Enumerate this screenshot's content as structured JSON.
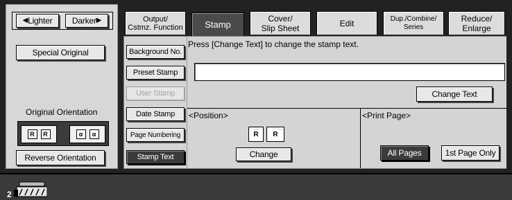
{
  "density": {
    "lighter_label": "Lighter",
    "darker_label": "Darker"
  },
  "left_panel": {
    "special_original_label": "Special Original",
    "original_orientation_label": "Original Orientation",
    "orientation_glyph_1": "R",
    "orientation_glyph_2": "R",
    "orientation_glyph_3": "α",
    "orientation_glyph_4": "α",
    "reverse_orientation_label": "Reverse Orientation"
  },
  "tabs": [
    {
      "line1": "Output/",
      "line2": "Cstmz. Function"
    },
    {
      "line1": "Stamp",
      "line2": ""
    },
    {
      "line1": "Cover/",
      "line2": "Slip Sheet"
    },
    {
      "line1": "Edit",
      "line2": ""
    },
    {
      "line1": "Dup./Combine/",
      "line2": "Series"
    },
    {
      "line1": "Reduce/",
      "line2": "Enlarge"
    }
  ],
  "stamp_menu": {
    "background_no": "Background No.",
    "preset_stamp": "Preset Stamp",
    "user_stamp": "User Stamp",
    "date_stamp": "Date Stamp",
    "page_numbering": "Page Numbering",
    "stamp_text": "Stamp Text"
  },
  "stamp_text_panel": {
    "instruction": "Press [Change Text] to change the stamp text.",
    "text_value": "",
    "change_text_label": "Change Text",
    "position_label": "<Position>",
    "position_glyph": "R",
    "change_label": "Change",
    "print_page_label": "<Print Page>",
    "all_pages_label": "All Pages",
    "first_page_only_label": "1st Page Only"
  },
  "status_bar": {
    "tray_number": "2"
  },
  "colors": {
    "panel": "#d4d4d4",
    "active": "#3b3b3b",
    "background": "#222222"
  }
}
